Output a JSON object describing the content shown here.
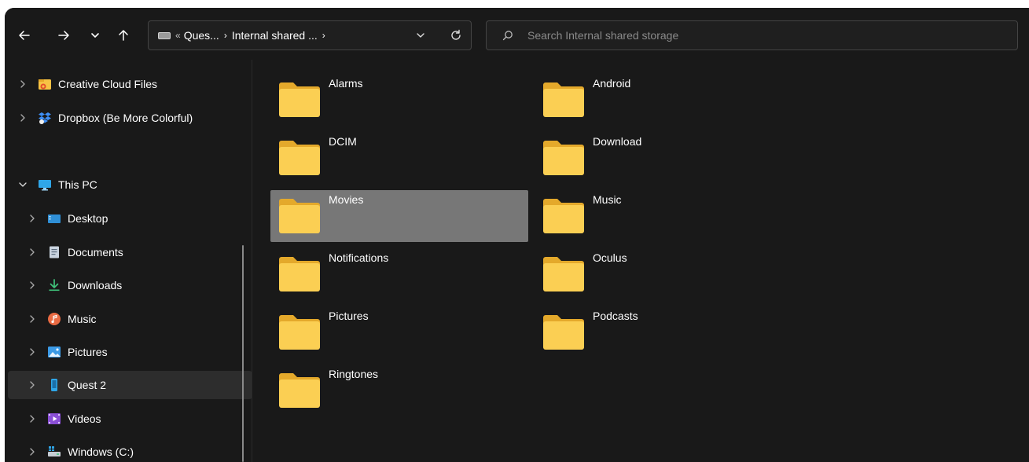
{
  "toolbar": {
    "back_icon": "arrow-left-icon",
    "forward_icon": "arrow-right-icon",
    "recent_icon": "chevron-down-icon",
    "up_icon": "arrow-up-icon"
  },
  "address_bar": {
    "overflow": "«",
    "crumbs": [
      "Ques...",
      "Internal shared ..."
    ],
    "separator": "›"
  },
  "search": {
    "placeholder": "Search Internal shared storage"
  },
  "sidebar": {
    "items": [
      {
        "label": "Creative Cloud Files",
        "icon": "creative-cloud-icon",
        "expanded": false,
        "indent": 0
      },
      {
        "label": "Dropbox (Be More Colorful)",
        "icon": "dropbox-icon",
        "expanded": false,
        "indent": 0
      },
      {
        "label": "This PC",
        "icon": "computer-icon",
        "expanded": true,
        "indent": 0
      },
      {
        "label": "Desktop",
        "icon": "desktop-icon",
        "expanded": false,
        "indent": 1
      },
      {
        "label": "Documents",
        "icon": "documents-icon",
        "expanded": false,
        "indent": 1
      },
      {
        "label": "Downloads",
        "icon": "download-icon",
        "expanded": false,
        "indent": 1
      },
      {
        "label": "Music",
        "icon": "music-icon",
        "expanded": false,
        "indent": 1
      },
      {
        "label": "Pictures",
        "icon": "pictures-icon",
        "expanded": false,
        "indent": 1
      },
      {
        "label": "Quest 2",
        "icon": "device-icon",
        "expanded": false,
        "indent": 1,
        "selected": true
      },
      {
        "label": "Videos",
        "icon": "videos-icon",
        "expanded": false,
        "indent": 1
      },
      {
        "label": "Windows (C:)",
        "icon": "drive-icon",
        "expanded": false,
        "indent": 1
      }
    ]
  },
  "folders": [
    {
      "name": "Alarms"
    },
    {
      "name": "Android"
    },
    {
      "name": "DCIM"
    },
    {
      "name": "Download"
    },
    {
      "name": "Movies",
      "selected": true
    },
    {
      "name": "Music"
    },
    {
      "name": "Notifications"
    },
    {
      "name": "Oculus"
    },
    {
      "name": "Pictures"
    },
    {
      "name": "Podcasts"
    },
    {
      "name": "Ringtones"
    }
  ],
  "colors": {
    "background": "#191919",
    "selected_tile": "#777777",
    "selected_nav": "#2d2d2d",
    "folder": "#f8c94a"
  }
}
